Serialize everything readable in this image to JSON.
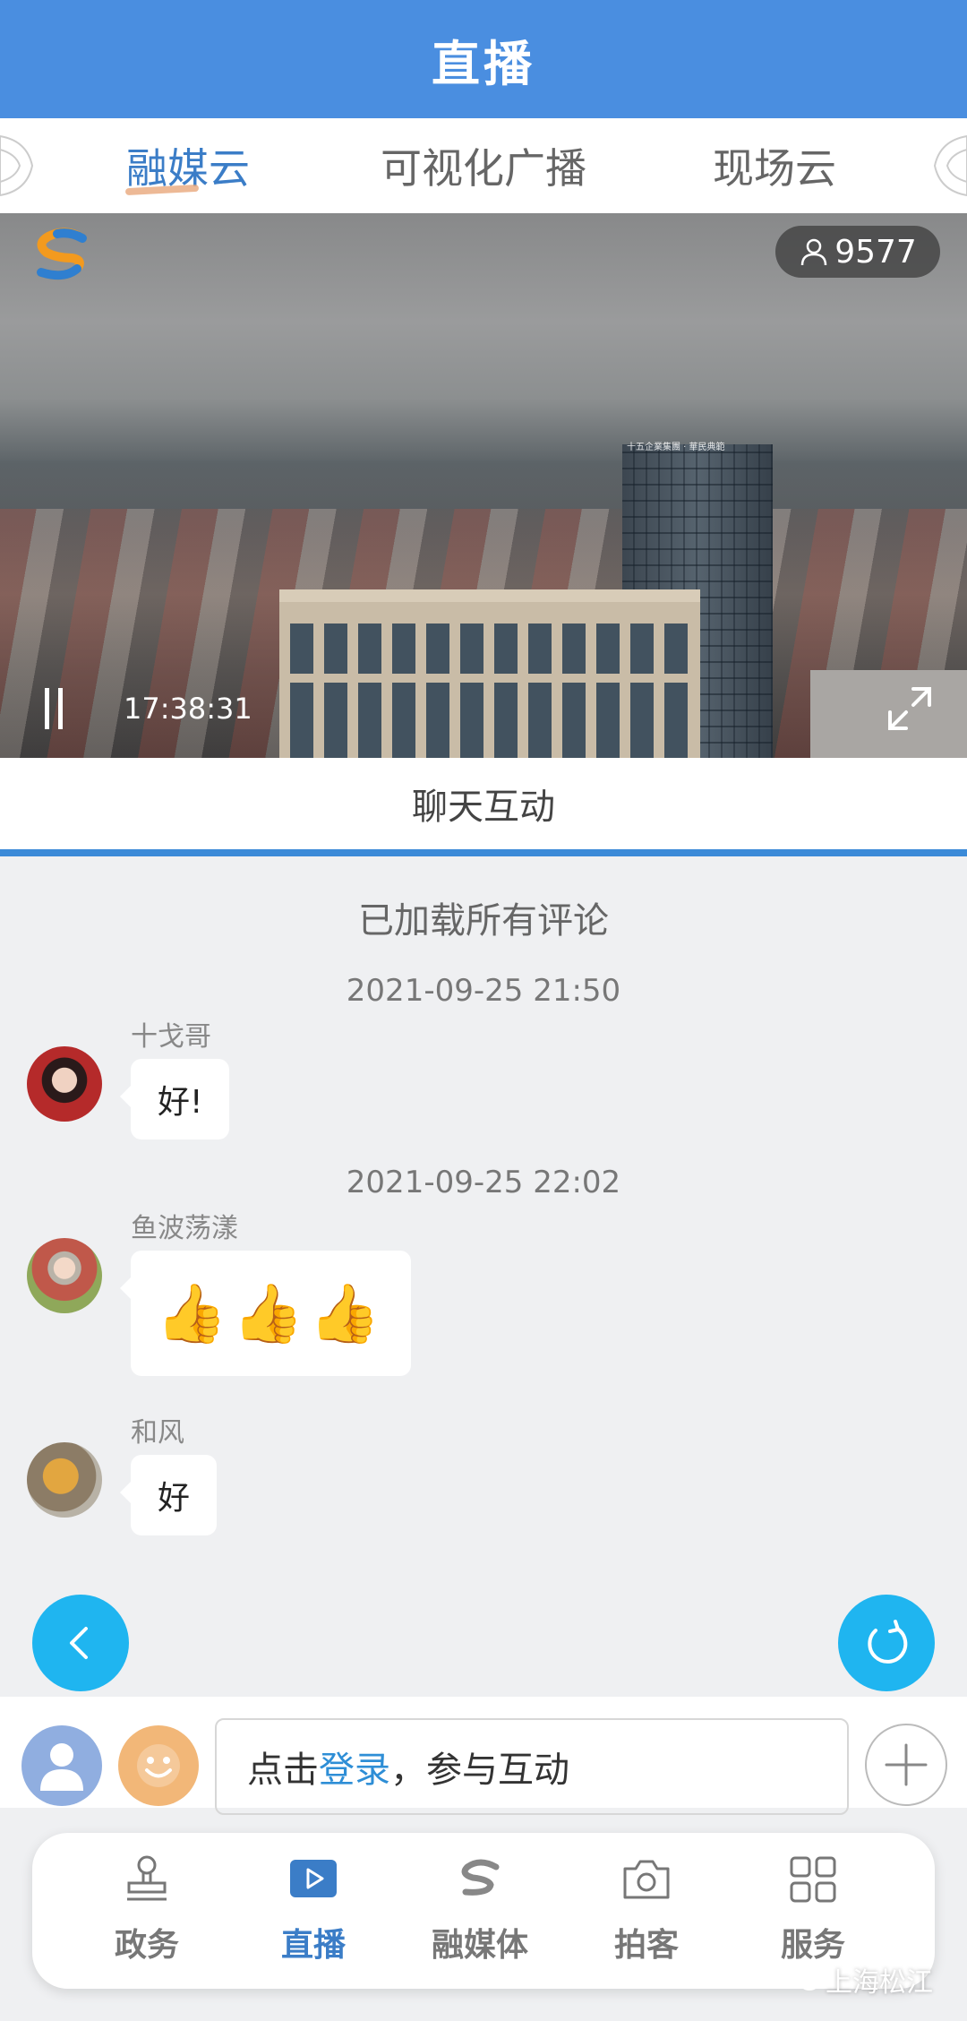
{
  "header": {
    "title": "直播"
  },
  "tabs": [
    {
      "label": "融媒云",
      "active": true
    },
    {
      "label": "可视化广播",
      "active": false
    },
    {
      "label": "现场云",
      "active": false
    }
  ],
  "video": {
    "viewer_count": "9577",
    "timecode": "17:38:31",
    "tower_sign": "十五企業集團 · 華民典範"
  },
  "chat_tab": {
    "label": "聊天互动"
  },
  "chat": {
    "loaded_text": "已加载所有评论",
    "groups": [
      {
        "timestamp": "2021-09-25 21:50",
        "messages": [
          {
            "user": "十戈哥",
            "text": "好!"
          }
        ]
      },
      {
        "timestamp": "2021-09-25 22:02",
        "messages": [
          {
            "user": "鱼波荡漾",
            "text": "👍👍👍"
          },
          {
            "user": "和风",
            "text": "好"
          }
        ]
      }
    ]
  },
  "input": {
    "prefix": "点击",
    "link": "登录",
    "suffix": "，参与互动"
  },
  "bottom_nav": [
    {
      "label": "政务",
      "icon": "stamp-icon",
      "active": false
    },
    {
      "label": "直播",
      "icon": "play-icon",
      "active": true
    },
    {
      "label": "融媒体",
      "icon": "brand-s-icon",
      "active": false
    },
    {
      "label": "拍客",
      "icon": "camera-icon",
      "active": false
    },
    {
      "label": "服务",
      "icon": "grid-icon",
      "active": false
    }
  ],
  "watermark": "上海松江",
  "colors": {
    "header_bg": "#4a8ee0",
    "accent": "#3b7dc7",
    "fab": "#1fb5f0",
    "link": "#2e8ed6"
  }
}
